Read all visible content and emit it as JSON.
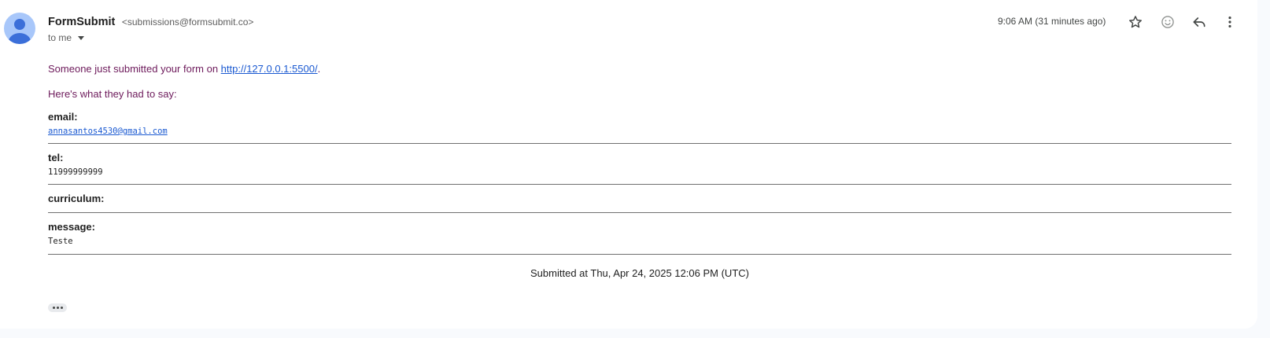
{
  "sender": {
    "name": "FormSubmit",
    "email": "<submissions@formsubmit.co>",
    "recipient_label": "to me"
  },
  "header": {
    "timestamp": "9:06 AM (31 minutes ago)",
    "icons": [
      "star-icon",
      "emoji-icon",
      "reply-icon",
      "more-vert-icon"
    ]
  },
  "body": {
    "intro_prefix": "Someone just submitted your form on ",
    "intro_link": "http://127.0.0.1:5500/",
    "intro_suffix": ".",
    "intro2": "Here's what they had to say:",
    "fields": [
      {
        "label": "email:",
        "value": "annasantos4530@gmail.com"
      },
      {
        "label": "tel:",
        "value": "11999999999"
      },
      {
        "label": "curriculum:",
        "value": ""
      },
      {
        "label": "message:",
        "value": "Teste"
      }
    ],
    "submitted": "Submitted at Thu, Apr 24, 2025 12:06 PM (UTC)"
  },
  "colors": {
    "intro_text": "#6d1a5b",
    "link": "#1a59d1",
    "avatar_bg": "#a8c7fa",
    "avatar_fg": "#3b6fd9"
  }
}
